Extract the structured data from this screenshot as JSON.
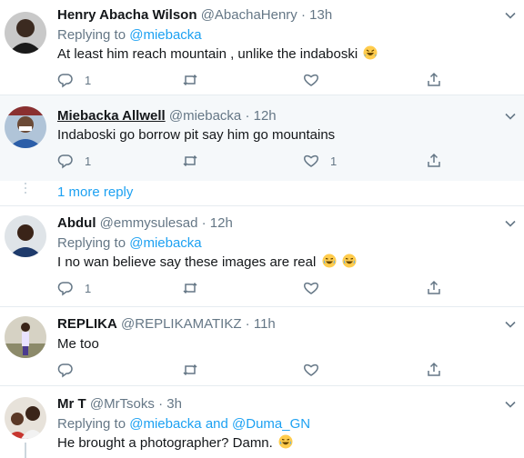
{
  "tweets": [
    {
      "name": "Henry Abacha Wilson",
      "handle": "@AbachaHenry",
      "time": "13h",
      "replying_prefix": "Replying to",
      "mentions": [
        "@miebacka"
      ],
      "text": "At least him reach mountain , unlike the indaboski",
      "emoji": [
        "rofl-emoji"
      ],
      "reply_count": "1",
      "retweet_count": "",
      "like_count": ""
    },
    {
      "name": "Miebacka Allwell",
      "handle": "@miebacka",
      "time": "12h",
      "text": "Indaboski go borrow pit say him go mountains",
      "reply_count": "1",
      "retweet_count": "",
      "like_count": "1"
    },
    {
      "name": "Abdul",
      "handle": "@emmysulesad",
      "time": "12h",
      "replying_prefix": "Replying to",
      "mentions": [
        "@miebacka"
      ],
      "text": "I no wan believe say these images are real",
      "emoji": [
        "joy-emoji",
        "joy-emoji"
      ],
      "reply_count": "1",
      "retweet_count": "",
      "like_count": ""
    },
    {
      "name": "REPLIKA",
      "handle": "@REPLIKAMATIKZ",
      "time": "11h",
      "text": "Me too",
      "reply_count": "",
      "retweet_count": "",
      "like_count": ""
    },
    {
      "name": "Mr T",
      "handle": "@MrTsoks",
      "time": "3h",
      "replying_prefix": "Replying to",
      "mentions": [
        "@miebacka",
        "@Duma_GN"
      ],
      "mention_joiner": "and",
      "text": "He brought a photographer? Damn.",
      "emoji": [
        "joy-emoji"
      ]
    }
  ],
  "more_reply_label": "1 more reply",
  "separator": "·",
  "colors": {
    "accent": "#1da1f2",
    "secondary_text": "#657786",
    "highlight_bg": "#f5f8fa",
    "divider": "#e6ecf0"
  },
  "icons": [
    "reply-icon",
    "retweet-icon",
    "like-icon",
    "share-icon",
    "chevron-down-icon"
  ]
}
